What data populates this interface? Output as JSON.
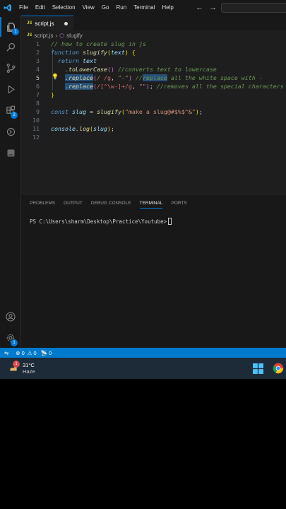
{
  "menu": [
    "File",
    "Edit",
    "Selection",
    "View",
    "Go",
    "Run",
    "Terminal",
    "Help"
  ],
  "badges": {
    "explorer": "1",
    "source_control": "2",
    "settings": "1",
    "weather": "1"
  },
  "tab": {
    "icon": "JS",
    "label": "script.js"
  },
  "breadcrumb": {
    "file_icon": "JS",
    "file": "script.js",
    "symbol": "slugify"
  },
  "editor": {
    "line_numbers": [
      "1",
      "2",
      "3",
      "4",
      "5",
      "6",
      "7",
      "8",
      "9",
      "10",
      "11",
      "12"
    ],
    "line1": "// how to create slug in js",
    "l2_kw": "function",
    "l2_fn": "slugify",
    "l2_open": "(",
    "l2_param": "text",
    "l2_close": ")",
    "l2_brace": "{",
    "l3_kw": "return",
    "l3_var": "text",
    "l4_fn": ".toLowerCase",
    "l4_parens": "()",
    "l4_cmt": "//converts text to lowercase",
    "l5_fn": ".replace",
    "l5_open": "(",
    "l5_rx": "/ /g",
    "l5_comma": ", ",
    "l5_str": "\"-\"",
    "l5_close": ")",
    "l5_cmt_a": " //",
    "l5_cmt_hl": "replace",
    "l5_cmt_b": " all the white space with -",
    "l6_fn": ".replace",
    "l6_open": "(",
    "l6_rx": "/[^\\w-]+/g",
    "l6_comma": ", ",
    "l6_str": "\"\"",
    "l6_close": ")",
    "l6_semi": ";",
    "l6_cmt": " //removes all the special characters",
    "l7_brace": "}",
    "l9_kw": "const",
    "l9_var": "slug",
    "l9_eq": " = ",
    "l9_fn": "slugify",
    "l9_open": "(",
    "l9_str": "\"make a slug@#$%$^&\"",
    "l9_close": ")",
    "l9_semi": ";",
    "l11_obj": "console",
    "l11_fn": ".log",
    "l11_open": "(",
    "l11_arg": "slug",
    "l11_close": ")",
    "l11_semi": ";"
  },
  "panel": {
    "tabs": [
      "PROBLEMS",
      "OUTPUT",
      "DEBUG CONSOLE",
      "TERMINAL",
      "PORTS"
    ],
    "active_tab": "TERMINAL",
    "prompt": "PS C:\\Users\\sharm\\Desktop\\Practice\\Youtube>"
  },
  "status": {
    "errors": "0",
    "warnings": "0",
    "ports": "0"
  },
  "taskbar": {
    "temperature": "31°C",
    "condition": "Haze"
  },
  "colors": {
    "accent": "#0078d4",
    "statusbar": "#007acc",
    "taskbar": "#1d2a38"
  }
}
